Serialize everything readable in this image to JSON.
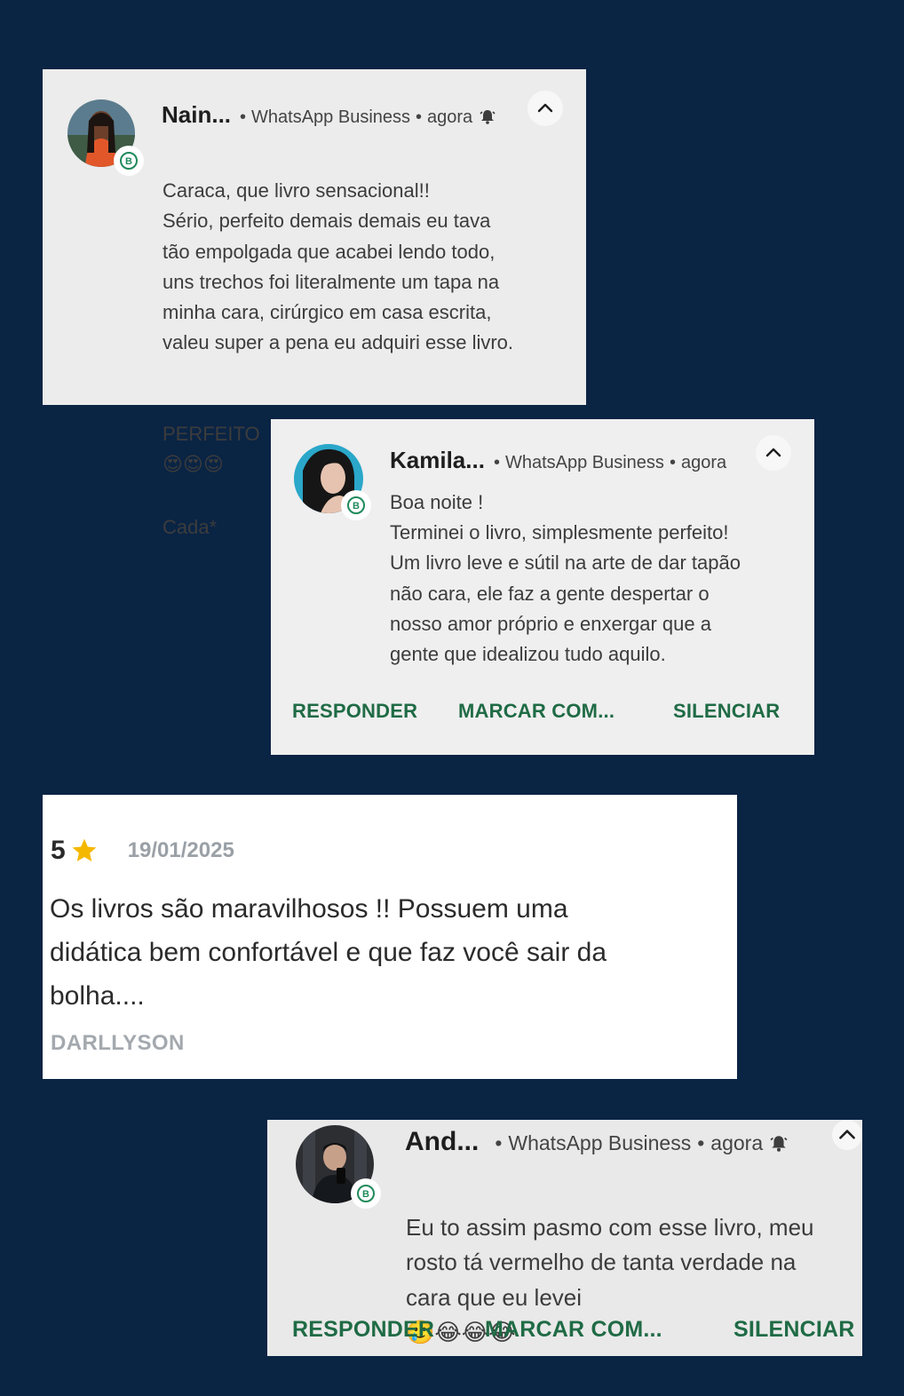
{
  "notifications": [
    {
      "name": "Nain...",
      "app": "WhatsApp Business",
      "time": "agora",
      "message": "Caraca, que livro sensacional!!\nSério, perfeito demais demais eu tava\ntão empolgada que acabei lendo todo,\nuns trechos foi literalmente um tapa na\nminha cara, cirúrgico em casa escrita,\nvaleu super a pena eu adquiri esse livro.",
      "message_last": "PERFEITO",
      "emoji": "😍😍😍",
      "message_tail": "Cada*",
      "icons": [
        "avatar-photo",
        "whatsapp-business-badge-icon",
        "bell-icon",
        "chevron-up-icon"
      ]
    },
    {
      "name": "Kamila...",
      "app": "WhatsApp Business",
      "time": "agora",
      "message": "Boa noite !\nTerminei o livro, simplesmente perfeito!\nUm livro  leve e sútil na arte de dar tapão\nnão cara, ele faz a gente despertar o\nnosso amor próprio e enxergar que a\ngente que idealizou tudo aquilo.",
      "actions": [
        "RESPONDER",
        "MARCAR COM...",
        "SILENCIAR"
      ]
    },
    {
      "name": "And...",
      "app": "WhatsApp Business",
      "time": "agora",
      "message": "Eu to assim pasmo com esse livro, meu\nrosto tá vermelho de tanta verdade na\ncara que eu levei",
      "emoji": "🥲😂😂😂",
      "actions": [
        "RESPONDER",
        "MARCAR COM...",
        "SILENCIAR"
      ]
    }
  ],
  "review": {
    "rating": "5",
    "star_color": "#f5b800",
    "date": "19/01/2025",
    "text": "Os livros são maravilhosos !! Possuem uma\ndidática bem confortável e que faz você sair da\nbolha....",
    "author": "DARLLYSON"
  },
  "colors": {
    "background": "#0a2444",
    "action_green": "#1f6b45",
    "badge_green": "#1f8a5b"
  }
}
